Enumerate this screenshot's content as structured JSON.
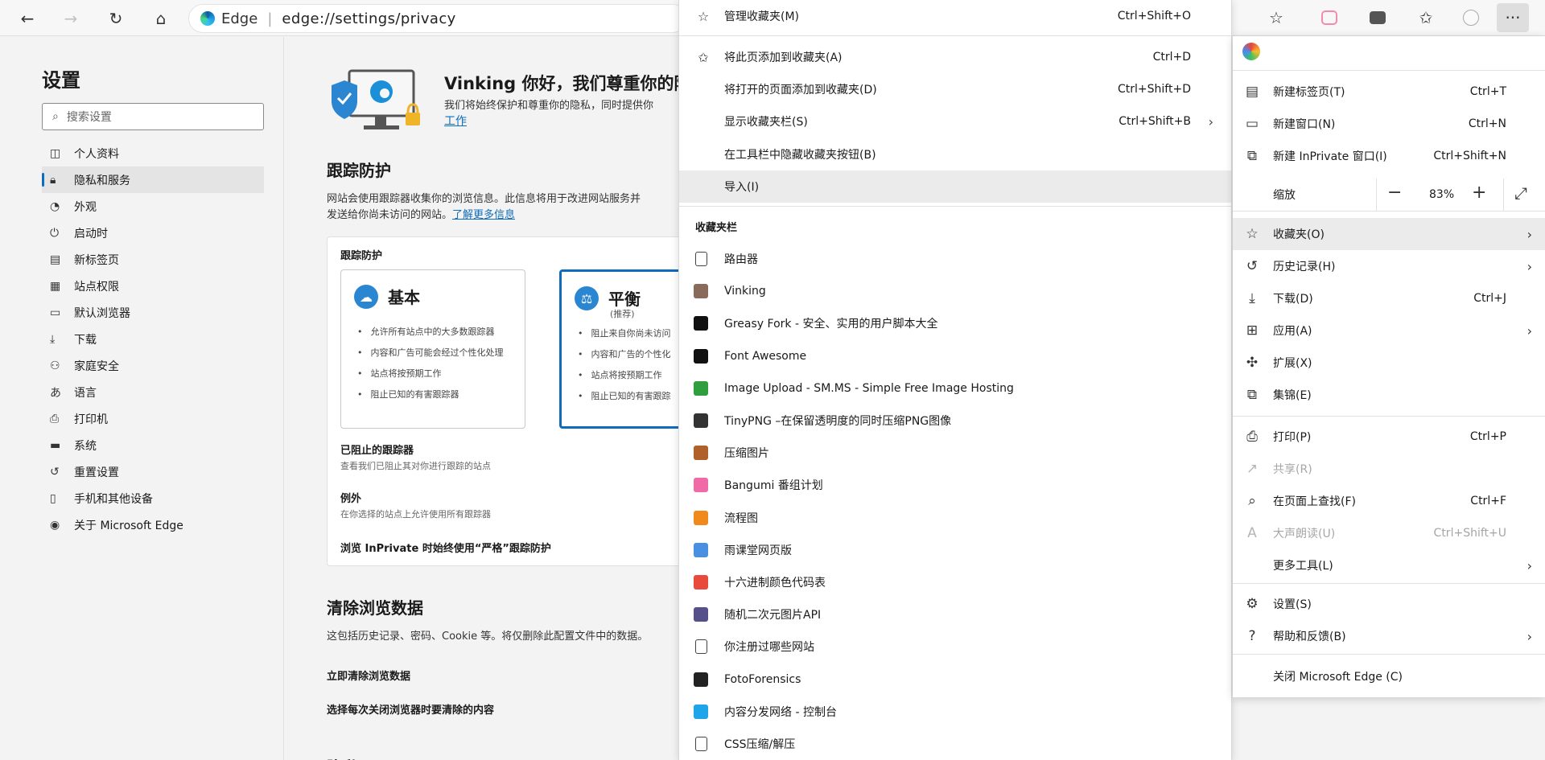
{
  "toolbar": {
    "site": "Edge",
    "separator": "|",
    "url": "edge://settings/privacy",
    "more_label": "···"
  },
  "settings_nav": {
    "title": "设置",
    "search_placeholder": "搜索设置",
    "items": [
      {
        "label": "个人资料",
        "icon": "profile-icon"
      },
      {
        "label": "隐私和服务",
        "icon": "lock-icon"
      },
      {
        "label": "外观",
        "icon": "palette-icon"
      },
      {
        "label": "启动时",
        "icon": "power-icon"
      },
      {
        "label": "新标签页",
        "icon": "newtab-icon"
      },
      {
        "label": "站点权限",
        "icon": "permissions-icon"
      },
      {
        "label": "默认浏览器",
        "icon": "browser-icon"
      },
      {
        "label": "下载",
        "icon": "download-icon"
      },
      {
        "label": "家庭安全",
        "icon": "family-icon"
      },
      {
        "label": "语言",
        "icon": "language-icon"
      },
      {
        "label": "打印机",
        "icon": "printer-icon"
      },
      {
        "label": "系统",
        "icon": "system-icon"
      },
      {
        "label": "重置设置",
        "icon": "reset-icon"
      },
      {
        "label": "手机和其他设备",
        "icon": "phone-icon"
      },
      {
        "label": "关于 Microsoft Edge",
        "icon": "edge-icon"
      }
    ]
  },
  "main": {
    "hero_title": "Vinking 你好，我们尊重你的隐",
    "hero_text": "我们将始终保护和尊重你的隐私，同时提供你",
    "hero_link": "工作",
    "tracking_title": "跟踪防护",
    "tracking_desc_1": "网站会使用跟踪器收集你的浏览信息。此信息将用于改进网站服务并",
    "tracking_desc_2": "发送给你尚未访问的网站。",
    "tracking_link": "了解更多信息",
    "card_caption": "跟踪防护",
    "basic": {
      "title": "基本",
      "bullets": [
        "允许所有站点中的大多数跟踪器",
        "内容和广告可能会经过个性化处理",
        "站点将按预期工作",
        "阻止已知的有害跟踪器"
      ]
    },
    "balanced": {
      "title": "平衡",
      "subtitle": "(推荐)",
      "bullets": [
        "阻止来自你尚未访问",
        "内容和广告的个性化",
        "站点将按预期工作",
        "阻止已知的有害跟踪"
      ]
    },
    "blocked_title": "已阻止的跟踪器",
    "blocked_desc": "查看我们已阻止其对你进行跟踪的站点",
    "exceptions_title": "例外",
    "exceptions_desc": "在你选择的站点上允许使用所有跟踪器",
    "inprivate": "浏览 InPrivate 时始终使用“严格”跟踪防护",
    "clear_title": "清除浏览数据",
    "clear_desc": "这包括历史记录、密码、Cookie 等。将仅删除此配置文件中的数据。",
    "clear_now": "立即清除浏览数据",
    "clear_on_close": "选择每次关闭浏览器时要清除的内容",
    "privacy_title": "隐私"
  },
  "favorites_menu": {
    "top_items": [
      {
        "label": "管理收藏夹(M)",
        "shortcut": "Ctrl+Shift+O",
        "icon": "manage-favorites-icon"
      },
      {
        "label": "将此页添加到收藏夹(A)",
        "shortcut": "Ctrl+D",
        "icon": "add-favorite-icon"
      },
      {
        "label": "将打开的页面添加到收藏夹(D)",
        "shortcut": "Ctrl+Shift+D",
        "icon": ""
      },
      {
        "label": "显示收藏夹栏(S)",
        "shortcut": "Ctrl+Shift+B",
        "icon": ""
      },
      {
        "label": "在工具栏中隐藏收藏夹按钮(B)",
        "shortcut": "",
        "icon": ""
      },
      {
        "label": "导入(I)",
        "shortcut": "",
        "icon": ""
      }
    ],
    "bar_header": "收藏夹栏",
    "bookmarks": [
      {
        "label": "路由器",
        "icon": "page-icon",
        "color": "#ffffff"
      },
      {
        "label": "Vinking",
        "icon": "vinking-icon",
        "color": "#8a6a5a"
      },
      {
        "label": "Greasy Fork - 安全、实用的用户脚本大全",
        "icon": "greasyfork-icon",
        "color": "#111111"
      },
      {
        "label": "Font Awesome",
        "icon": "fontawesome-icon",
        "color": "#111111"
      },
      {
        "label": "Image Upload - SM.MS - Simple Free Image Hosting",
        "icon": "smms-icon",
        "color": "#2e9e3e"
      },
      {
        "label": "TinyPNG –在保留透明度的同时压缩PNG图像",
        "icon": "tinypng-icon",
        "color": "#333333"
      },
      {
        "label": "压缩图片",
        "icon": "compress-icon",
        "color": "#b0602a"
      },
      {
        "label": "Bangumi 番组计划",
        "icon": "bangumi-icon",
        "color": "#f06aa8"
      },
      {
        "label": "流程图",
        "icon": "flowchart-icon",
        "color": "#f08a1c"
      },
      {
        "label": "雨课堂网页版",
        "icon": "yuketang-icon",
        "color": "#4a90e2"
      },
      {
        "label": "十六进制颜色代码表",
        "icon": "colorcode-icon",
        "color": "#e84b3c"
      },
      {
        "label": "随机二次元图片API",
        "icon": "anime-api-icon",
        "color": "#56508a"
      },
      {
        "label": "你注册过哪些网站",
        "icon": "page-icon",
        "color": "#ffffff"
      },
      {
        "label": "FotoForensics",
        "icon": "fotoforensics-icon",
        "color": "#222222"
      },
      {
        "label": "内容分发网络 - 控制台",
        "icon": "cloud-icon",
        "color": "#1ea5e9"
      },
      {
        "label": "CSS压缩/解压",
        "icon": "page-icon",
        "color": "#ffffff"
      }
    ]
  },
  "main_menu": {
    "items_a": [
      {
        "label": "新建标签页(T)",
        "shortcut": "Ctrl+T",
        "icon": "new-tab-icon"
      },
      {
        "label": "新建窗口(N)",
        "shortcut": "Ctrl+N",
        "icon": "new-window-icon"
      },
      {
        "label": "新建 InPrivate 窗口(I)",
        "shortcut": "Ctrl+Shift+N",
        "icon": "inprivate-icon"
      }
    ],
    "zoom_label": "缩放",
    "zoom_value": "83%",
    "items_b": [
      {
        "label": "收藏夹(O)",
        "shortcut": "",
        "icon": "favorites-icon",
        "arrow": true
      },
      {
        "label": "历史记录(H)",
        "shortcut": "",
        "icon": "history-icon",
        "arrow": true
      },
      {
        "label": "下载(D)",
        "shortcut": "Ctrl+J",
        "icon": "download-icon",
        "arrow": false
      },
      {
        "label": "应用(A)",
        "shortcut": "",
        "icon": "apps-icon",
        "arrow": true
      },
      {
        "label": "扩展(X)",
        "shortcut": "",
        "icon": "extensions-icon",
        "arrow": false
      },
      {
        "label": "集锦(E)",
        "shortcut": "",
        "icon": "collections-icon",
        "arrow": false
      }
    ],
    "items_c": [
      {
        "label": "打印(P)",
        "shortcut": "Ctrl+P",
        "icon": "print-icon"
      },
      {
        "label": "共享(R)",
        "shortcut": "",
        "icon": "share-icon"
      },
      {
        "label": "在页面上查找(F)",
        "shortcut": "Ctrl+F",
        "icon": "find-icon"
      },
      {
        "label": "大声朗读(U)",
        "shortcut": "Ctrl+Shift+U",
        "icon": "read-aloud-icon"
      },
      {
        "label": "更多工具(L)",
        "shortcut": "",
        "icon": "",
        "arrow": true
      }
    ],
    "items_d": [
      {
        "label": "设置(S)",
        "icon": "settings-icon",
        "arrow": false
      },
      {
        "label": "帮助和反馈(B)",
        "icon": "help-icon",
        "arrow": true
      }
    ],
    "close": "关闭 Microsoft Edge (C)"
  }
}
